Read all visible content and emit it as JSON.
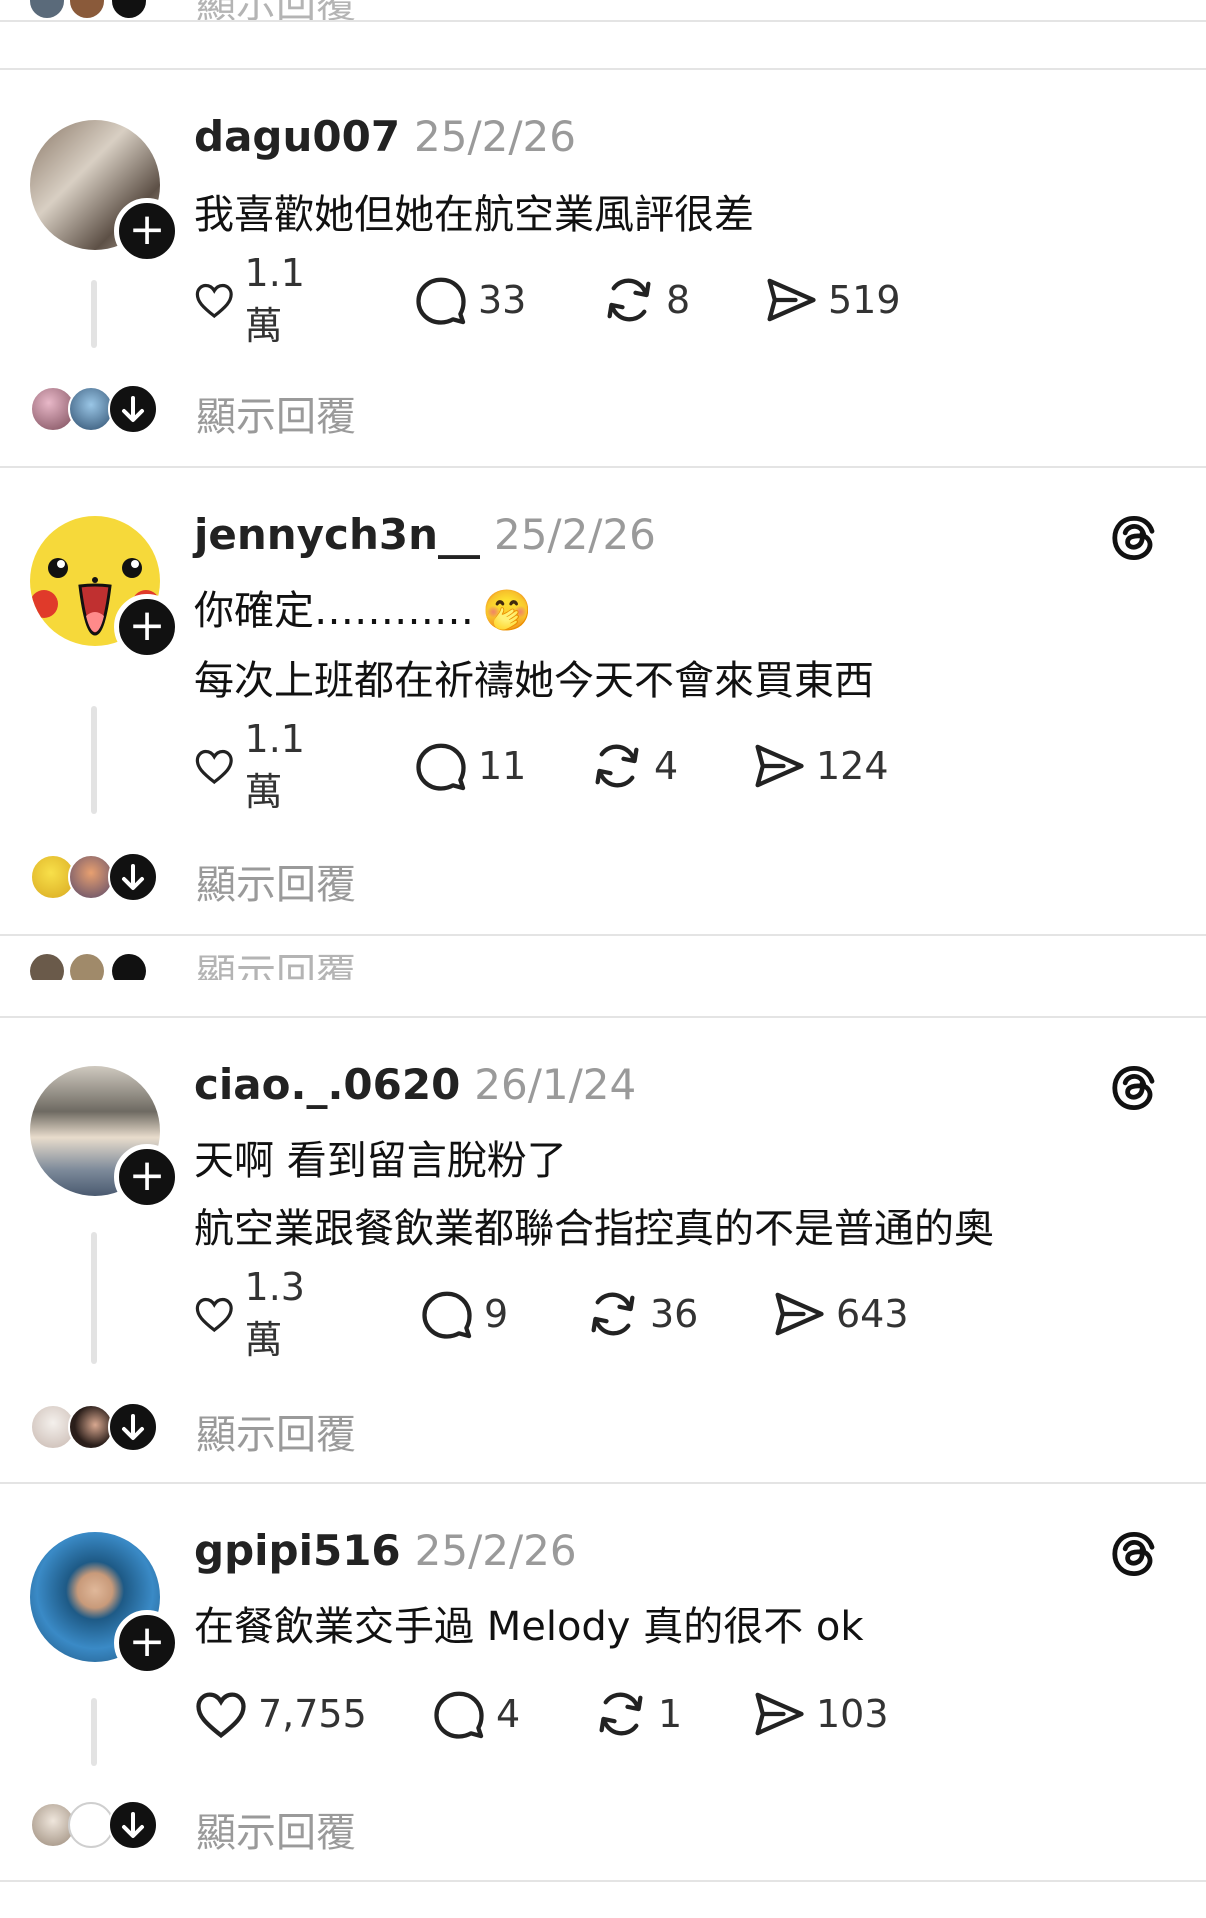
{
  "show_replies_label": "顯示回覆",
  "posts": [
    {
      "username": "dagu007",
      "date": "25/2/26",
      "lines": [
        "我喜歡她但她在航空業風評很差"
      ],
      "likes": "1.1萬",
      "comments": "33",
      "reposts": "8",
      "shares": "519",
      "threads_icon": false
    },
    {
      "username": "jennych3n__",
      "date": "25/2/26",
      "lines": [
        "你確定…………",
        "每次上班都在祈禱她今天不會來買東西"
      ],
      "emoji": "🤭",
      "likes": "1.1萬",
      "comments": "11",
      "reposts": "4",
      "shares": "124",
      "threads_icon": true
    },
    {
      "username": "ciao._.0620",
      "date": "26/1/24",
      "lines": [
        "天啊 看到留言脫粉了",
        "航空業跟餐飲業都聯合指控真的不是普通的奧"
      ],
      "likes": "1.3萬",
      "comments": "9",
      "reposts": "36",
      "shares": "643",
      "threads_icon": true
    },
    {
      "username": "gpipi516",
      "date": "25/2/26",
      "lines": [
        "在餐飲業交手過 Melody 真的很不 ok"
      ],
      "likes": "7,755",
      "comments": "4",
      "reposts": "1",
      "shares": "103",
      "threads_icon": true
    }
  ],
  "icons": {
    "like": "heart-icon",
    "comment": "speech-bubble-icon",
    "repost": "repost-arrows-icon",
    "share": "send-icon",
    "follow": "plus-icon",
    "expand": "arrow-down-icon",
    "brand": "threads-logo-icon"
  }
}
